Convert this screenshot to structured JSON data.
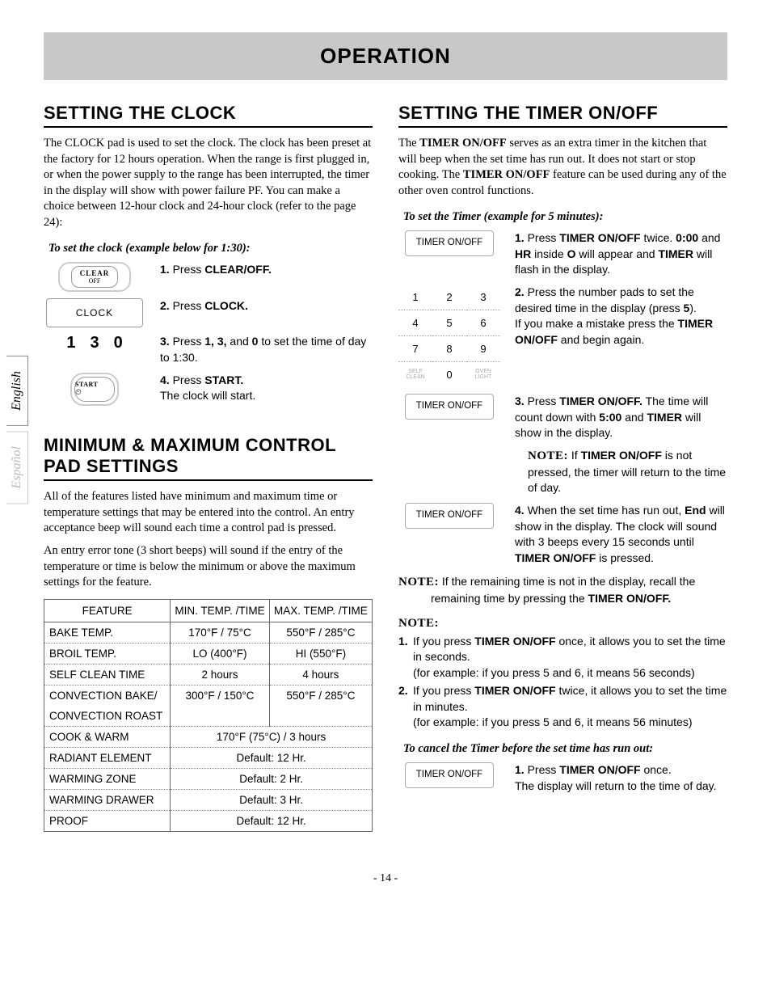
{
  "header": {
    "title": "OPERATION"
  },
  "tabs": {
    "english": "English",
    "espanol": "Español"
  },
  "left": {
    "clock": {
      "heading": "SETTING THE CLOCK",
      "intro": "The CLOCK pad is used to set the clock. The clock has been preset at the factory for 12 hours operation. When the range is first plugged in, or when the power supply to the range has been interrupted, the timer in the display will show with power failure PF. You can make a choice between 12-hour clock and 24-hour clock (refer to the page 24):",
      "sub": "To set the clock (example below for 1:30):",
      "btn_clear_top": "CLEAR",
      "btn_clear_bot": "OFF",
      "btn_clock": "CLOCK",
      "digits": [
        "1",
        "3",
        "0"
      ],
      "btn_start": "START",
      "s1_a": "1.",
      "s1_b": " Press ",
      "s1_c": "CLEAR/OFF.",
      "s2_a": "2.",
      "s2_b": " Press ",
      "s2_c": "CLOCK.",
      "s3_a": "3.",
      "s3_b": " Press ",
      "s3_c": "1, 3,",
      "s3_d": " and ",
      "s3_e": "0",
      "s3_f": " to set the time of day to 1:30.",
      "s4_a": "4.",
      "s4_b": " Press ",
      "s4_c": "START.",
      "s4_d": "The clock will start."
    },
    "minmax": {
      "heading": "MINIMUM & MAXIMUM CONTROL PAD SETTINGS",
      "p1": "All of the features listed have minimum and maximum time or temperature settings that may be entered into the control. An entry acceptance beep will sound each time a control pad is pressed.",
      "p2": "An entry error tone (3 short beeps) will sound if the entry of the temperature or time is below the minimum or above the maximum settings for the feature.",
      "th1": "FEATURE",
      "th2": "MIN. TEMP. /TIME",
      "th3": "MAX. TEMP. /TIME",
      "r1": [
        "BAKE TEMP.",
        "170°F / 75°C",
        "550°F / 285°C"
      ],
      "r2": [
        "BROIL TEMP.",
        "LO (400°F)",
        "HI (550°F)"
      ],
      "r3": [
        "SELF CLEAN TIME",
        "2 hours",
        "4 hours"
      ],
      "r4a": [
        "CONVECTION BAKE/",
        "300°F / 150°C",
        "550°F / 285°C"
      ],
      "r4b": [
        "CONVECTION ROAST",
        "",
        ""
      ],
      "r5": [
        "COOK & WARM",
        "170°F (75°C) / 3 hours"
      ],
      "r6": [
        "RADIANT ELEMENT",
        "Default: 12 Hr."
      ],
      "r7": [
        "WARMING ZONE",
        "Default: 2 Hr."
      ],
      "r8": [
        "WARMING DRAWER",
        "Default: 3 Hr."
      ],
      "r9": [
        "PROOF",
        "Default: 12 Hr."
      ]
    }
  },
  "right": {
    "heading": "SETTING THE TIMER ON/OFF",
    "intro_a": "The ",
    "intro_b": "TIMER ON/OFF",
    "intro_c": " serves as an extra timer in the kitchen that will beep when the set time has run out. It does not start or stop cooking. The ",
    "intro_d": "TIMER ON/OFF",
    "intro_e": " feature can be used during any of the other oven control functions.",
    "sub": "To set the Timer (example for 5 minutes):",
    "btn_timer": "TIMER ON/OFF",
    "kp": [
      [
        "1",
        "2",
        "3"
      ],
      [
        "4",
        "5",
        "6"
      ],
      [
        "7",
        "8",
        "9"
      ],
      [
        "SELF CLEAN",
        "0",
        "OVEN LIGHT"
      ]
    ],
    "s1_a": "1.",
    "s1_b": " Press ",
    "s1_c": "TIMER ON/OFF",
    "s1_d": " twice. ",
    "s1_e": "0:00",
    "s1_f": " and ",
    "s1_g": "HR",
    "s1_h": " inside ",
    "s1_i": "O",
    "s1_j": " will appear and ",
    "s1_k": "TIMER",
    "s1_l": " will flash in the display.",
    "s2_a": "2.",
    "s2_b": " Press the number pads to set the desired time in the display (press ",
    "s2_c": "5",
    "s2_d": ").",
    "s2_e": "If you make a mistake press the ",
    "s2_f": "TIMER ON/OFF",
    "s2_g": " and begin again.",
    "s3_a": "3.",
    "s3_b": " Press ",
    "s3_c": "TIMER ON/OFF.",
    "s3_d": " The time will count down with ",
    "s3_e": "5:00",
    "s3_f": " and ",
    "s3_g": "TIMER",
    "s3_h": " will show in the display.",
    "note3_label": "NOTE:",
    "note3_a": " If ",
    "note3_b": "TIMER ON/OFF",
    "note3_c": " is not pressed, the timer will return to the time of day.",
    "s4_a": "4.",
    "s4_b": " When the set time has run out, ",
    "s4_c": "End",
    "s4_d": " will show in the display. The clock will sound with 3 beeps every 15 seconds until ",
    "s4_e": "TIMER ON/OFF",
    "s4_f": " is pressed.",
    "noteA_label": "NOTE:",
    "noteA_a": " If the remaining time is not in the display, recall the remaining time by pressing the ",
    "noteA_b": "TIMER ON/OFF.",
    "noteB_label": "NOTE:",
    "nb1_a": "1.",
    "nb1_b": " If you press ",
    "nb1_c": "TIMER ON/OFF",
    "nb1_d": " once, it allows you to set the time in seconds.",
    "nb1_e": "(for example: if you press 5 and 6, it means 56 seconds)",
    "nb2_a": "2.",
    "nb2_b": " If you press ",
    "nb2_c": "TIMER ON/OFF",
    "nb2_d": " twice, it allows you to set the time in minutes.",
    "nb2_e": "(for example: if you press 5 and 6, it means 56 minutes)",
    "cancel_sub": "To cancel the Timer before the set time has run out:",
    "c1_a": "1.",
    "c1_b": " Press ",
    "c1_c": "TIMER ON/OFF",
    "c1_d": " once.",
    "c1_e": "The display will return to the time of day."
  },
  "pagenum": "- 14 -"
}
